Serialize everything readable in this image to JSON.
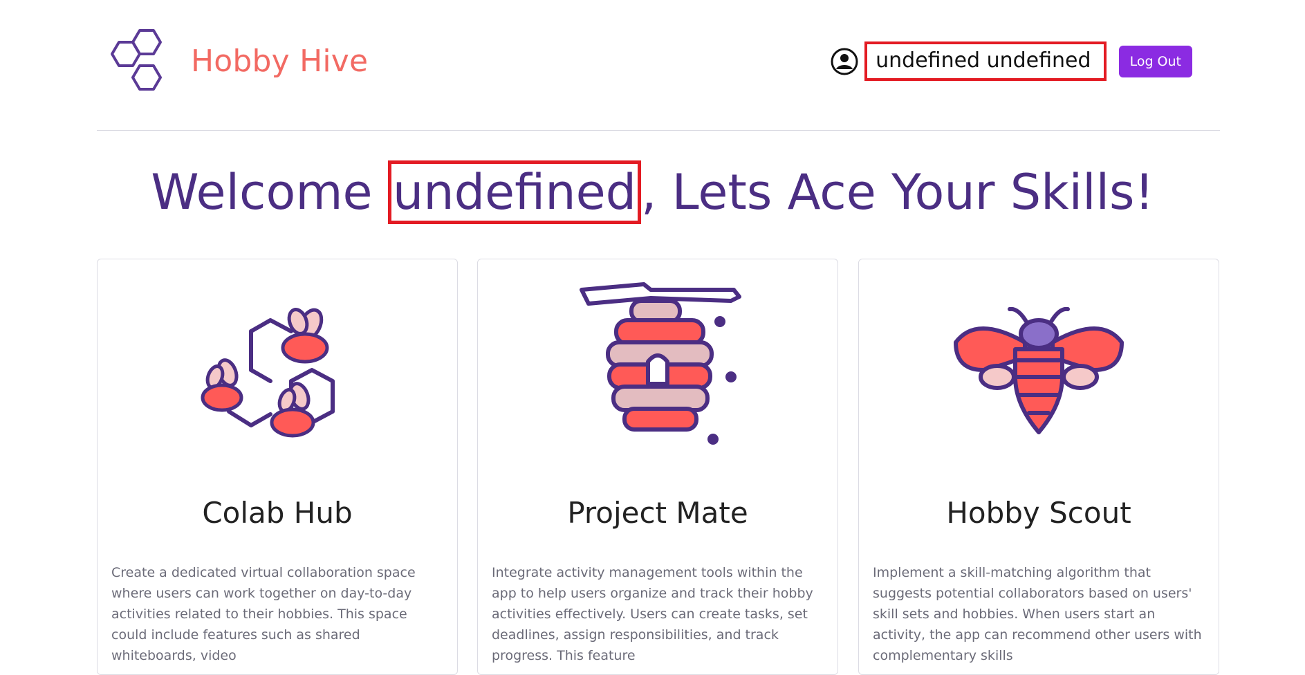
{
  "header": {
    "brand_name": "Hobby Hive",
    "username": "undefined undefined",
    "logout_label": "Log Out"
  },
  "welcome": {
    "prefix": "Welcome ",
    "name": "undefined",
    "suffix": ", Lets Ace Your Skills!"
  },
  "cards": [
    {
      "title": "Colab Hub",
      "icon": "bees-honeycomb-icon",
      "description": "Create a dedicated virtual collaboration space where users can work together on day-to-day activities related to their hobbies. This space could include features such as shared whiteboards, video"
    },
    {
      "title": "Project Mate",
      "icon": "beehive-icon",
      "description": "Integrate activity management tools within the app to help users organize and track their hobby activities effectively. Users can create tasks, set deadlines, assign responsibilities, and track progress. This feature"
    },
    {
      "title": "Hobby Scout",
      "icon": "bee-icon",
      "description": "Implement a skill-matching algorithm that suggests potential collaborators based on users' skill sets and hobbies. When users start an activity, the app can recommend other users with complementary skills"
    }
  ],
  "colors": {
    "brand": "#f26a63",
    "primary_purple": "#4b2e83",
    "button_purple": "#8b2be2",
    "highlight_red": "#e31b23"
  }
}
